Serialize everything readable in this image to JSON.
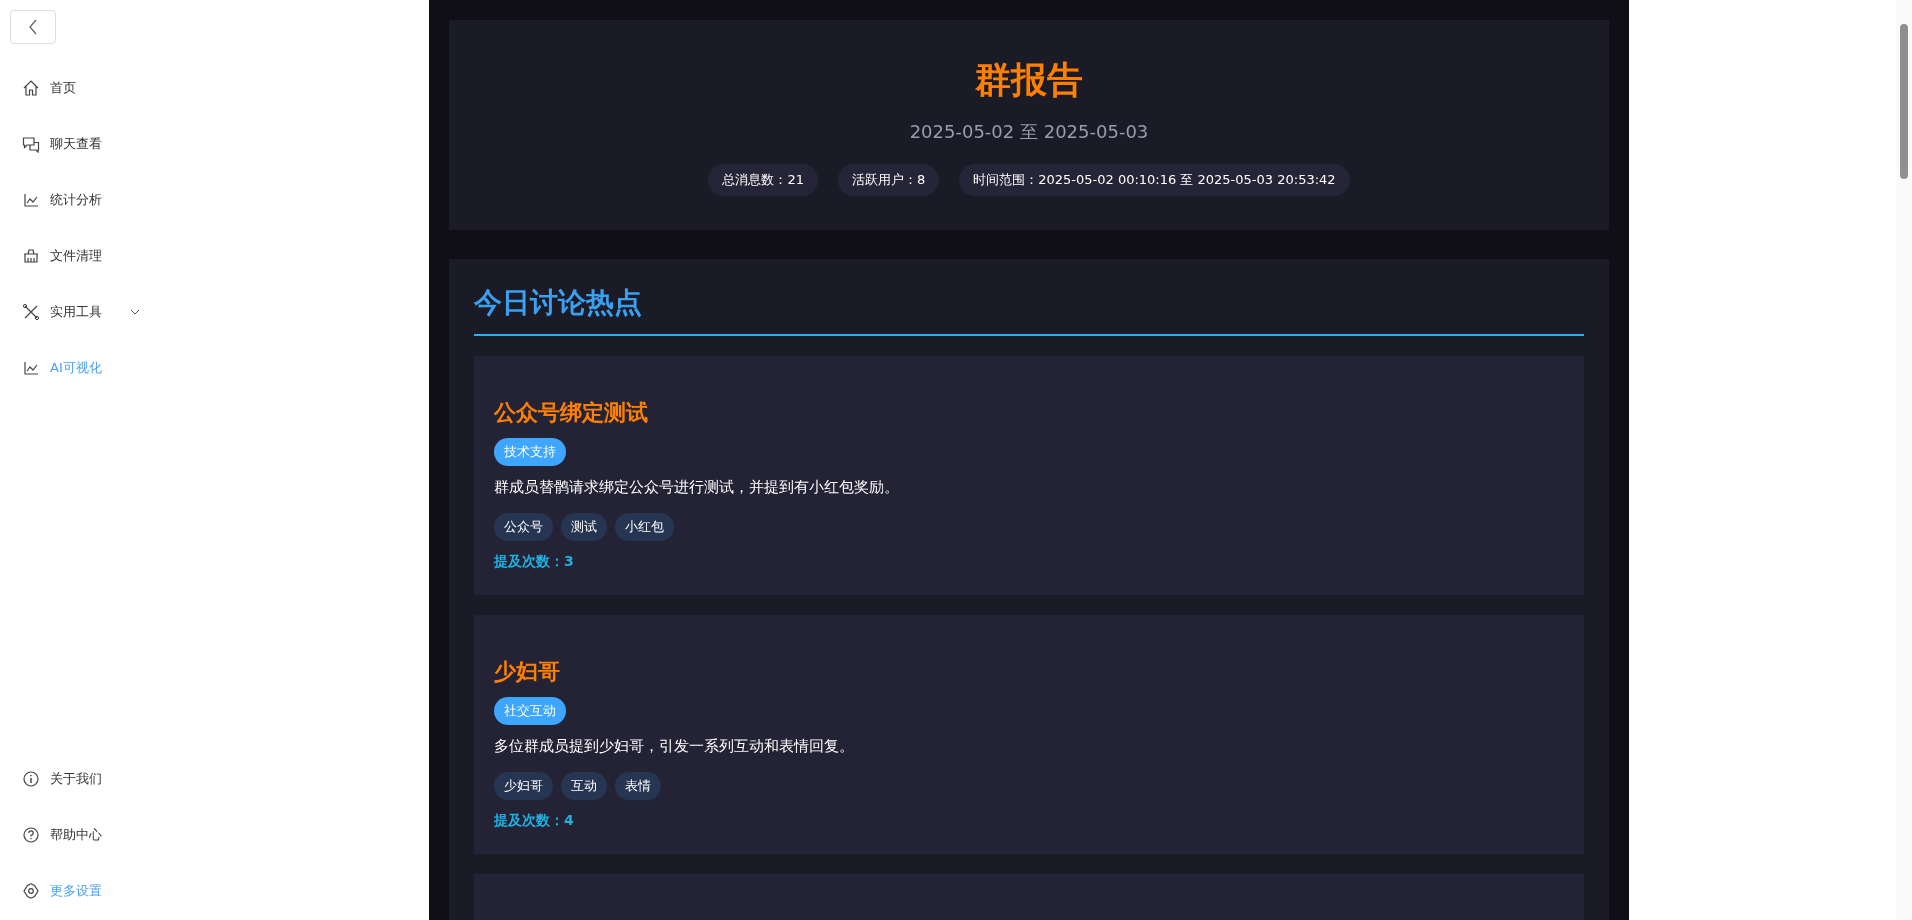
{
  "sidebar": {
    "nav_items": [
      {
        "label": "首页",
        "kind": "home",
        "selected": false,
        "expandable": false
      },
      {
        "label": "聊天查看",
        "kind": "chat",
        "selected": false,
        "expandable": false
      },
      {
        "label": "统计分析",
        "kind": "chart",
        "selected": false,
        "expandable": false
      },
      {
        "label": "文件清理",
        "kind": "basket",
        "selected": false,
        "expandable": false
      },
      {
        "label": "实用工具",
        "kind": "tools",
        "selected": false,
        "expandable": true
      },
      {
        "label": "AI可视化",
        "kind": "chart",
        "selected": true,
        "expandable": false
      }
    ],
    "footer_items": [
      {
        "label": "关于我们",
        "kind": "info",
        "selected": false
      },
      {
        "label": "帮助中心",
        "kind": "help",
        "selected": false
      },
      {
        "label": "更多设置",
        "kind": "gear",
        "selected": true
      }
    ]
  },
  "report": {
    "title": "群报告",
    "date_range": "2025-05-02 至 2025-05-03",
    "stats": [
      {
        "label": "总消息数：",
        "value": "21"
      },
      {
        "label": "活跃用户：",
        "value": "8"
      },
      {
        "label": "时间范围：",
        "value": "2025-05-02 00:10:16 至 2025-05-03 20:53:42"
      }
    ]
  },
  "hot_topics": {
    "heading": "今日讨论热点",
    "topics": [
      {
        "title": "公众号绑定测试",
        "category": "技术支持",
        "description": "群成员替鹘请求绑定公众号进行测试，并提到有小红包奖励。",
        "keywords": [
          "公众号",
          "测试",
          "小红包"
        ],
        "mentions": "提及次数：3"
      },
      {
        "title": "少妇哥",
        "category": "社交互动",
        "description": "多位群成员提到少妇哥，引发一系列互动和表情回复。",
        "keywords": [
          "少妇哥",
          "互动",
          "表情"
        ],
        "mentions": "提及次数：4"
      }
    ]
  }
}
